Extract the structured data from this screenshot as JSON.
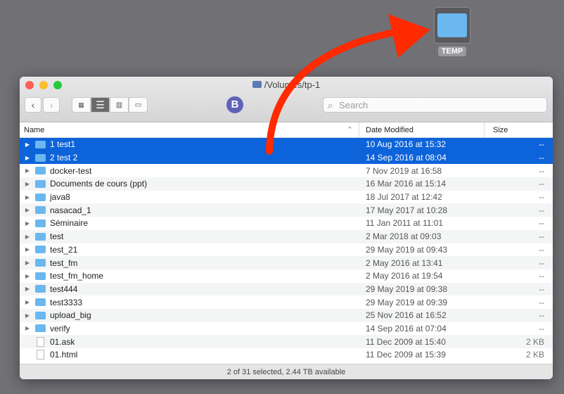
{
  "desktop": {
    "folder_label": "TEMP"
  },
  "window": {
    "title": "/Volumes/tp-1",
    "search_placeholder": "Search",
    "columns": {
      "name": "Name",
      "date": "Date Modified",
      "size": "Size"
    },
    "rows": [
      {
        "name": "1 test1",
        "date": "10 Aug 2016 at 15:32",
        "size": "--",
        "type": "folder",
        "selected": true
      },
      {
        "name": "2 test 2",
        "date": "14 Sep 2016 at 08:04",
        "size": "--",
        "type": "folder",
        "selected": true
      },
      {
        "name": "docker-test",
        "date": "7 Nov 2019 at 16:58",
        "size": "--",
        "type": "folder"
      },
      {
        "name": "Documents de cours (ppt)",
        "date": "16 Mar 2016 at 15:14",
        "size": "--",
        "type": "folder"
      },
      {
        "name": "java8",
        "date": "18 Jul 2017 at 12:42",
        "size": "--",
        "type": "folder"
      },
      {
        "name": "nasacad_1",
        "date": "17 May 2017 at 10:28",
        "size": "--",
        "type": "folder"
      },
      {
        "name": "Séminaire",
        "date": "11 Jan 2011 at 11:01",
        "size": "--",
        "type": "folder"
      },
      {
        "name": "test",
        "date": "2 Mar 2018 at 09:03",
        "size": "--",
        "type": "folder"
      },
      {
        "name": "test_21",
        "date": "29 May 2019 at 09:43",
        "size": "--",
        "type": "folder"
      },
      {
        "name": "test_fm",
        "date": "2 May 2016 at 13:41",
        "size": "--",
        "type": "folder"
      },
      {
        "name": "test_fm_home",
        "date": "2 May 2016 at 19:54",
        "size": "--",
        "type": "folder"
      },
      {
        "name": "test444",
        "date": "29 May 2019 at 09:38",
        "size": "--",
        "type": "folder"
      },
      {
        "name": "test3333",
        "date": "29 May 2019 at 09:39",
        "size": "--",
        "type": "folder"
      },
      {
        "name": "upload_big",
        "date": "25 Nov 2016 at 16:52",
        "size": "--",
        "type": "folder"
      },
      {
        "name": "verify",
        "date": "14 Sep 2016 at 07:04",
        "size": "--",
        "type": "folder"
      },
      {
        "name": "01.ask",
        "date": "11 Dec 2009 at 15:40",
        "size": "2 KB",
        "type": "file"
      },
      {
        "name": "01.html",
        "date": "11 Dec 2009 at 15:39",
        "size": "2 KB",
        "type": "file"
      }
    ],
    "status": "2 of 31 selected, 2.44 TB available"
  },
  "colors": {
    "selection": "#0d63d9",
    "arrow": "#ff2a00",
    "folder": "#6bb7ef"
  }
}
